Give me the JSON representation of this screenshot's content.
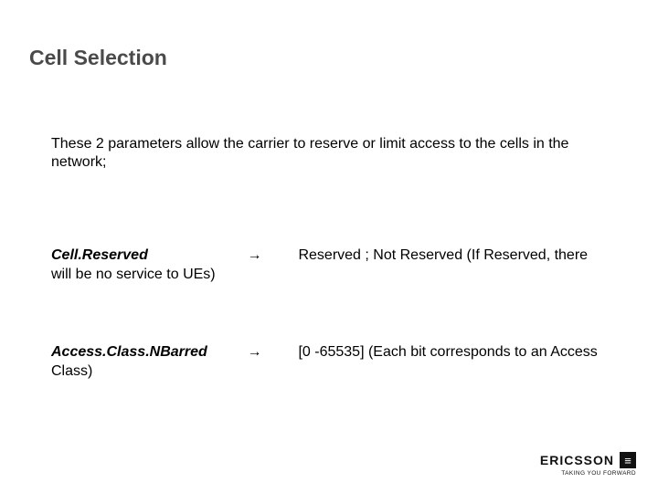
{
  "title": "Cell Selection",
  "intro": "These 2 parameters allow the carrier to reserve or limit access to the cells in the network;",
  "params": {
    "cellReserved": {
      "name": "Cell.Reserved",
      "arrow": "→",
      "desc": "Reserved ; Not Reserved (If Reserved, there will be no service to UEs)"
    },
    "accessClass": {
      "name": "Access.Class.NBarred",
      "arrow": "→",
      "desc": "[0 -65535] (Each bit corresponds to an Access Class)"
    }
  },
  "footer": {
    "brand": "ERICSSON",
    "logoGlyph": "≡",
    "tagline": "TAKING YOU FORWARD"
  }
}
